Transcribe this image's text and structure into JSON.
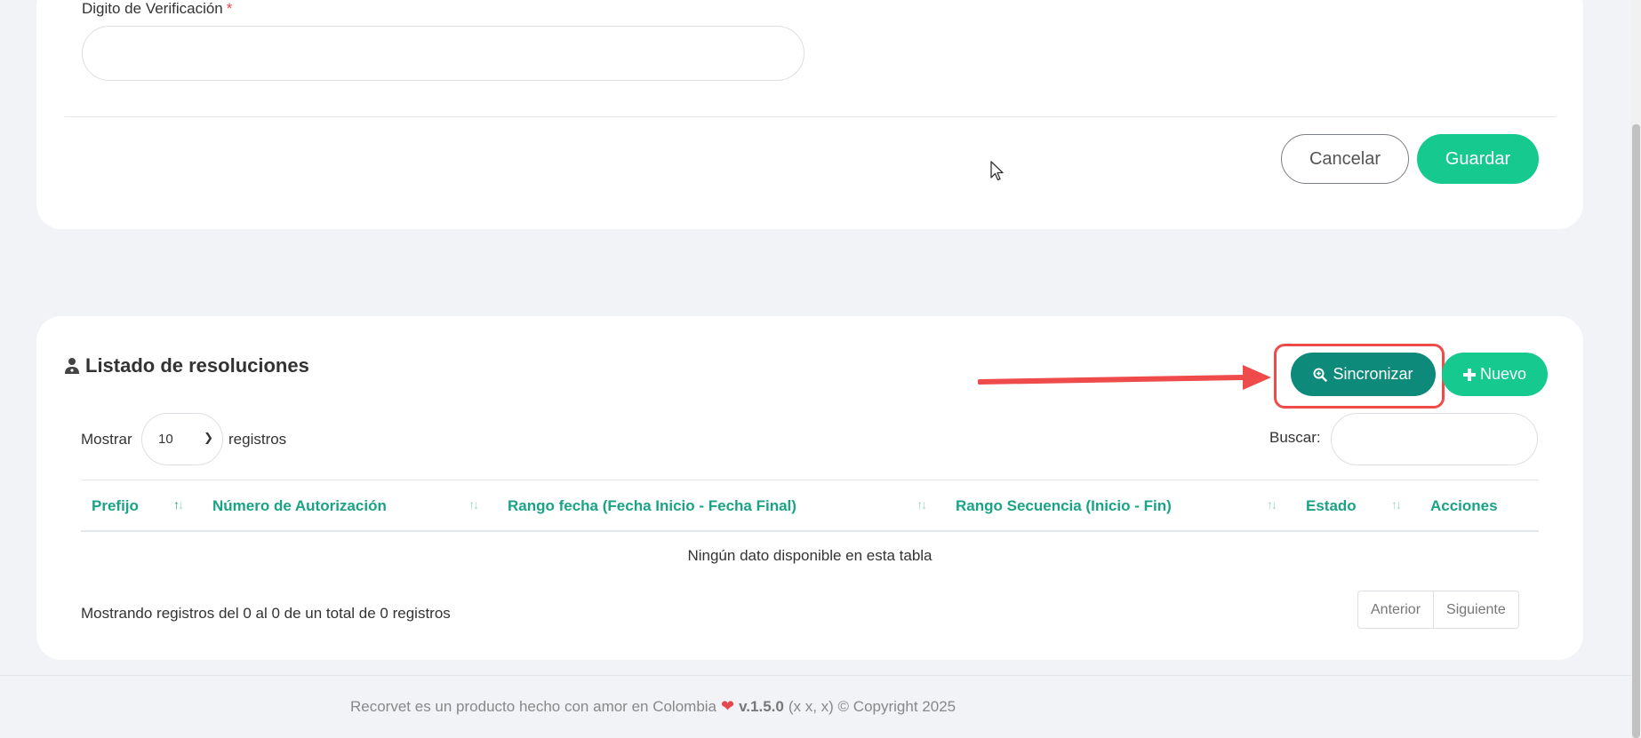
{
  "form": {
    "verification_label": "Digito de Verificación",
    "required_mark": "*",
    "verification_value": "",
    "cancel_label": "Cancelar",
    "save_label": "Guardar"
  },
  "list": {
    "title": "Listado de resoluciones",
    "sync_label": "Sincronizar",
    "new_label": "Nuevo",
    "show_label": "Mostrar",
    "page_size": "10",
    "records_label": "registros",
    "search_label": "Buscar:",
    "search_value": "",
    "columns": [
      "Prefijo",
      "Número de Autorización",
      "Rango fecha (Fecha Inicio - Fecha Final)",
      "Rango Secuencia (Inicio - Fin)",
      "Estado",
      "Acciones"
    ],
    "empty_message": "Ningún dato disponible en esta tabla",
    "info": "Mostrando registros del 0 al 0 de un total de 0 registros",
    "prev_label": "Anterior",
    "next_label": "Siguiente"
  },
  "footer": {
    "text": "Recorvet es un producto hecho con amor en Colombia",
    "version": "v.1.5.0",
    "extra": "(x x, x) © Copyright 2025"
  },
  "colors": {
    "primary": "#15c98f",
    "sync": "#0e8a7a",
    "highlight": "#ef4b4b",
    "header_text": "#1aa384"
  },
  "icons": {
    "sync": "search-plus-icon",
    "new": "plus-icon",
    "title": "user-doctor-icon",
    "footer": "heart-icon"
  }
}
